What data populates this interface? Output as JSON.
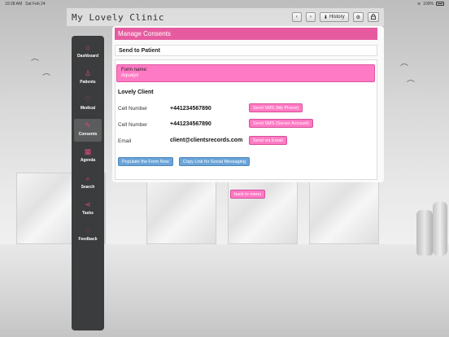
{
  "status_bar": {
    "time": "10:28 AM",
    "date": "Sat Feb 24",
    "battery": "100%"
  },
  "header": {
    "app_title": "My Lovely Clinic",
    "back_glyph": "‹",
    "forward_glyph": "›",
    "history_label": "History",
    "settings_glyph": "⚙",
    "lock_glyph": "🔒"
  },
  "sidebar": {
    "items": [
      {
        "label": "Dashboard",
        "icon": "home-icon",
        "glyph": "⌂"
      },
      {
        "label": "Patients",
        "icon": "patients-icon",
        "glyph": "♙"
      },
      {
        "label": "Medical",
        "icon": "heart-icon",
        "glyph": "♡"
      },
      {
        "label": "Consents",
        "icon": "pen-icon",
        "glyph": "✎"
      },
      {
        "label": "Agenda",
        "icon": "calendar-icon",
        "glyph": "▦"
      },
      {
        "label": "Search",
        "icon": "search-icon",
        "glyph": "⌕"
      },
      {
        "label": "Tasks",
        "icon": "share-icon",
        "glyph": "⋖"
      },
      {
        "label": "Feedback",
        "icon": "chat-icon",
        "glyph": "◌"
      }
    ],
    "active": "Consents"
  },
  "main": {
    "section_title": "Manage Consents",
    "subsection_title": "Send to Patient",
    "form_name_label": "Form name:",
    "form_name_value": "Aqualyx",
    "client_name": "Lovely Client",
    "rows": [
      {
        "label": "Cell Number",
        "value": "+441234567890",
        "button": "Send SMS (My Phone)"
      },
      {
        "label": "Cell Number",
        "value": "+441234567890",
        "button": "Send SMS (Server Account)"
      },
      {
        "label": "Email",
        "value": "client@clientsrecords.com",
        "button": "Send via Email"
      }
    ],
    "populate_button": "Populate the Form Now",
    "copy_link_button": "Copy Link for Social Messaging",
    "back_button": "back to menu"
  },
  "colors": {
    "accent": "#e65ba0",
    "pink_button": "#ff7ac4",
    "blue_button": "#6aa4d9",
    "sidebar_bg": "#3a3c3d"
  }
}
